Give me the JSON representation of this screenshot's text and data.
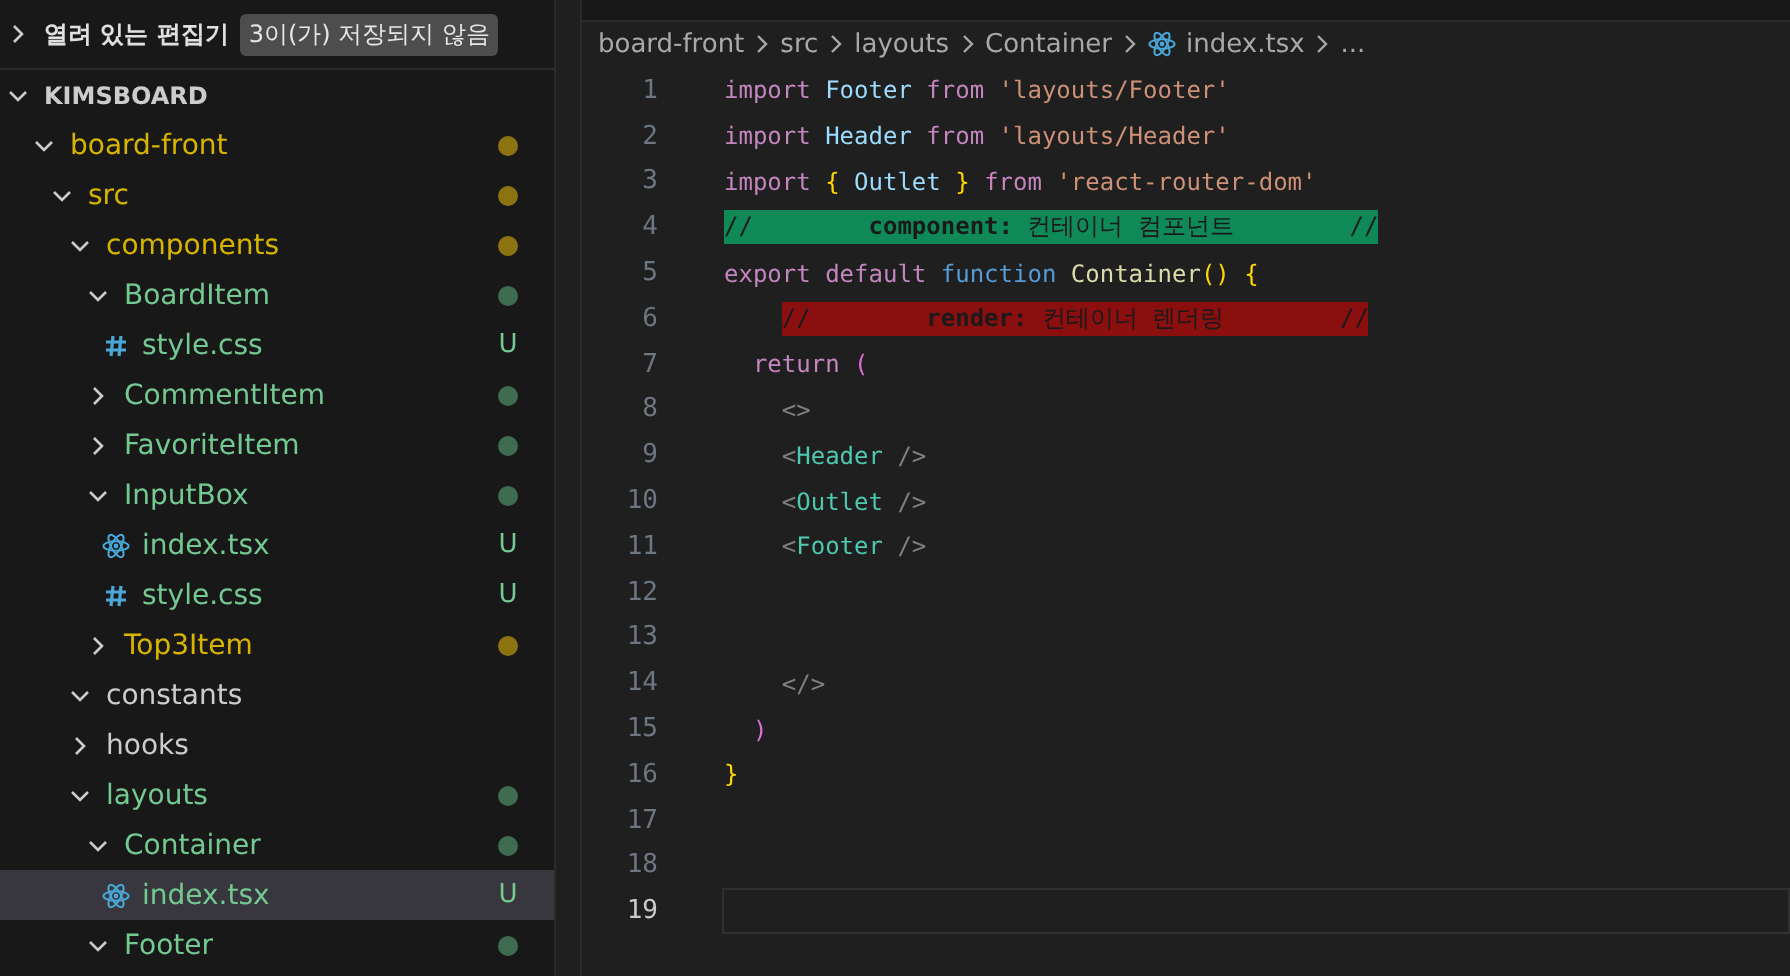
{
  "sidebar": {
    "open_editors": {
      "label": "열려 있는 편집기",
      "badge": "3이(가) 저장되지 않음",
      "expanded": false
    },
    "root": {
      "label": "KIMSBOARD",
      "expanded": true,
      "children": [
        {
          "label": "board-front",
          "kind": "folder",
          "expanded": true,
          "color": "#8b7410",
          "children": [
            {
              "label": "src",
              "kind": "folder",
              "expanded": true,
              "color": "#8b7410",
              "children": [
                {
                  "label": "components",
                  "kind": "folder",
                  "expanded": true,
                  "color": "#8b7410",
                  "children": [
                    {
                      "label": "BoardItem",
                      "kind": "folder",
                      "expanded": true,
                      "color": "#3f6b50",
                      "children": [
                        {
                          "label": "style.css",
                          "kind": "css",
                          "status": "U",
                          "selected": false
                        }
                      ]
                    },
                    {
                      "label": "CommentItem",
                      "kind": "folder",
                      "expanded": false,
                      "color": "#3f6b50"
                    },
                    {
                      "label": "FavoriteItem",
                      "kind": "folder",
                      "expanded": false,
                      "color": "#3f6b50"
                    },
                    {
                      "label": "InputBox",
                      "kind": "folder",
                      "expanded": true,
                      "color": "#3f6b50",
                      "children": [
                        {
                          "label": "index.tsx",
                          "kind": "react",
                          "status": "U",
                          "selected": false
                        },
                        {
                          "label": "style.css",
                          "kind": "css",
                          "status": "U",
                          "selected": false
                        }
                      ]
                    },
                    {
                      "label": "Top3Item",
                      "kind": "folder",
                      "expanded": false,
                      "color": "#8b7410"
                    }
                  ]
                },
                {
                  "label": "constants",
                  "kind": "folder",
                  "expanded": true
                },
                {
                  "label": "hooks",
                  "kind": "folder",
                  "expanded": false
                },
                {
                  "label": "layouts",
                  "kind": "folder",
                  "expanded": true,
                  "color": "#3f6b50",
                  "children": [
                    {
                      "label": "Container",
                      "kind": "folder",
                      "expanded": true,
                      "color": "#3f6b50",
                      "children": [
                        {
                          "label": "index.tsx",
                          "kind": "react",
                          "status": "U",
                          "selected": true
                        }
                      ]
                    },
                    {
                      "label": "Footer",
                      "kind": "folder",
                      "expanded": true,
                      "color": "#3f6b50"
                    }
                  ]
                }
              ]
            }
          ]
        }
      ]
    }
  },
  "breadcrumb": [
    {
      "label": "board-front",
      "kind": "text"
    },
    {
      "label": "src",
      "kind": "text"
    },
    {
      "label": "layouts",
      "kind": "text"
    },
    {
      "label": "Container",
      "kind": "text"
    },
    {
      "label": "index.tsx",
      "kind": "react"
    },
    {
      "label": "...",
      "kind": "text"
    }
  ],
  "editor": {
    "lines": [
      {
        "number": "1",
        "current": false,
        "tokens": [
          {
            "text": "import",
            "kind": "keyword"
          },
          {
            "text": " Footer",
            "kind": "variable"
          },
          {
            "text": " from",
            "kind": "keyword"
          },
          {
            "text": " 'layouts/Footer'",
            "kind": "string"
          }
        ]
      },
      {
        "number": "2",
        "current": false,
        "tokens": [
          {
            "text": "import",
            "kind": "keyword"
          },
          {
            "text": " Header",
            "kind": "variable"
          },
          {
            "text": " from",
            "kind": "keyword"
          },
          {
            "text": " 'layouts/Header'",
            "kind": "string"
          }
        ]
      },
      {
        "number": "3",
        "current": false,
        "tokens": [
          {
            "text": "import",
            "kind": "keyword"
          },
          {
            "text": " {",
            "kind": "brace"
          },
          {
            "text": " Outlet",
            "kind": "variable"
          },
          {
            "text": " }",
            "kind": "brace"
          },
          {
            "text": " from",
            "kind": "keyword"
          },
          {
            "text": " 'react-router-dom'",
            "kind": "string"
          }
        ]
      },
      {
        "number": "4",
        "current": false,
        "tokens": [
          {
            "text": "//        **component:** 컨테이너 컴포넌트        //",
            "kind": "banner",
            "indented": false,
            "color": "#0f8a57"
          }
        ]
      },
      {
        "number": "5",
        "current": false,
        "tokens": [
          {
            "text": "export",
            "kind": "keyword"
          },
          {
            "text": " default",
            "kind": "keyword"
          },
          {
            "text": " function",
            "kind": "storage"
          },
          {
            "text": " Container",
            "kind": "function"
          },
          {
            "text": "()",
            "kind": "brace"
          },
          {
            "text": " {",
            "kind": "brace"
          }
        ]
      },
      {
        "number": "6",
        "current": false,
        "tokens": [
          {
            "text": "//        **render:** 컨테이너 렌더링        //",
            "kind": "banner",
            "indented": true,
            "color": "#8c0f0f"
          }
        ]
      },
      {
        "number": "7",
        "current": false,
        "tokens": [
          {
            "text": "  return",
            "kind": "keyword"
          },
          {
            "text": " (",
            "kind": "paren"
          }
        ]
      },
      {
        "number": "8",
        "current": false,
        "tokens": [
          {
            "text": "    <>",
            "kind": "punct"
          }
        ]
      },
      {
        "number": "9",
        "current": false,
        "tokens": [
          {
            "text": "    <",
            "kind": "punct"
          },
          {
            "text": "Header",
            "kind": "tag"
          },
          {
            "text": " />",
            "kind": "punct"
          }
        ]
      },
      {
        "number": "10",
        "current": false,
        "tokens": [
          {
            "text": "    <",
            "kind": "punct"
          },
          {
            "text": "Outlet",
            "kind": "tag"
          },
          {
            "text": " />",
            "kind": "punct"
          }
        ]
      },
      {
        "number": "11",
        "current": false,
        "tokens": [
          {
            "text": "    <",
            "kind": "punct"
          },
          {
            "text": "Footer",
            "kind": "tag"
          },
          {
            "text": " />",
            "kind": "punct"
          }
        ]
      },
      {
        "number": "12",
        "current": false
      },
      {
        "number": "13",
        "current": false
      },
      {
        "number": "14",
        "current": false,
        "tokens": [
          {
            "text": "    </>",
            "kind": "punct"
          }
        ]
      },
      {
        "number": "15",
        "current": false,
        "tokens": [
          {
            "text": "  )",
            "kind": "paren"
          }
        ]
      },
      {
        "number": "16",
        "current": false,
        "tokens": [
          {
            "text": "}",
            "kind": "brace"
          }
        ]
      },
      {
        "number": "17",
        "current": false
      },
      {
        "number": "18",
        "current": false
      },
      {
        "number": "19",
        "current": true
      }
    ]
  }
}
